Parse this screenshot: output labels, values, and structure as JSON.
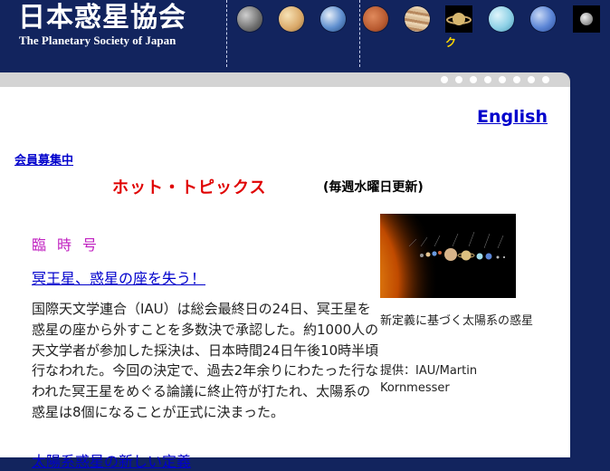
{
  "header": {
    "title": "日本惑星協会",
    "subtitle": "The Planetary Society of Japan",
    "ku_label": "ク",
    "planets": [
      {
        "name": "mercury-icon",
        "color": "#8a8a8a"
      },
      {
        "name": "venus-icon",
        "color": "#d9b47a"
      },
      {
        "name": "earth-icon",
        "color": "#4a7fc0"
      },
      {
        "name": "mars-icon",
        "color": "#c4643a"
      },
      {
        "name": "jupiter-icon",
        "color": "#c9a27a"
      },
      {
        "name": "saturn-icon",
        "color": "#d8b870"
      },
      {
        "name": "uranus-icon",
        "color": "#8fd1e6"
      },
      {
        "name": "neptune-icon",
        "color": "#5b85d6"
      },
      {
        "name": "pluto-icon",
        "color": "#b8b8b8"
      }
    ]
  },
  "nav": {
    "english": "English",
    "member_recruitment": "会員募集中"
  },
  "topics": {
    "title": "ホット・トピックス",
    "weekly_note": "(毎週水曜日更新)"
  },
  "article": {
    "special_issue": "臨時号",
    "headline": "冥王星、惑星の座を失う！",
    "body": "国際天文学連合（IAU）は総会最終日の24日、冥王星を惑星の座から外すことを多数決で承認した。約1000人の天文学者が参加した採決は、日本時間24日午後10時半頃行なわれた。今回の決定で、過去2年余りにわたった行なわれた冥王星をめぐる論議に終止符が打たれ、太陽系の惑星は8個になることが正式に決まった。",
    "next_headline": "太陽系惑星の新しい定義"
  },
  "figure": {
    "caption": "新定義に基づく太陽系の惑星",
    "credit": "提供：IAU/Martin Kornmesser"
  },
  "colors": {
    "navy": "#12245e",
    "link": "#0000cc",
    "hot_topics": "#e00000",
    "special": "#c020c0"
  }
}
